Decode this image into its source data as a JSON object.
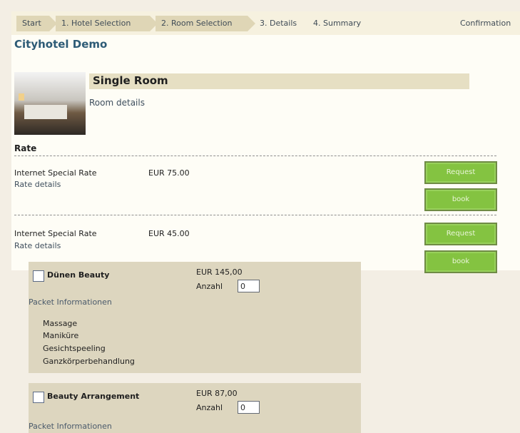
{
  "breadcrumb": [
    {
      "label": "Start",
      "state": "done"
    },
    {
      "label": "1. Hotel Selection",
      "state": "done"
    },
    {
      "label": "2. Room Selection",
      "state": "current"
    },
    {
      "label": "3. Details",
      "state": "upcoming"
    },
    {
      "label": "4. Summary",
      "state": "upcoming"
    },
    {
      "label": "Confirmation",
      "state": "upcoming"
    }
  ],
  "hotel_title": "Cityhotel Demo",
  "room": {
    "name": "Single Room",
    "details_link": "Room details",
    "photo_icon": "room-photo"
  },
  "rate_heading": "Rate",
  "rates": [
    {
      "name": "Internet Special Rate",
      "price": "EUR  75.00",
      "details_link": "Rate details",
      "request_label": "Request",
      "book_label": "book"
    },
    {
      "name": "Internet Special Rate",
      "price": "EUR  45.00",
      "details_link": "Rate details",
      "request_label": "Request",
      "book_label": "book"
    }
  ],
  "packages": [
    {
      "name": "Dünen Beauty",
      "price": "EUR  145,00",
      "anzahl_label": "Anzahl",
      "qty": "0",
      "checked": false,
      "info_label": "Packet Informationen",
      "services": [
        "Massage",
        "Maniküre",
        "Gesichtspeeling",
        "Ganzkörperbehandlung"
      ]
    },
    {
      "name": "Beauty Arrangement",
      "price": "EUR  87,00",
      "anzahl_label": "Anzahl",
      "qty": "0",
      "checked": false,
      "info_label": "Packet Informationen",
      "services": []
    }
  ],
  "colors": {
    "accent_green": "#84c341",
    "title_blue": "#2d5b76",
    "header_band": "#e6dfc3",
    "package_bg": "#ddd6bf"
  }
}
